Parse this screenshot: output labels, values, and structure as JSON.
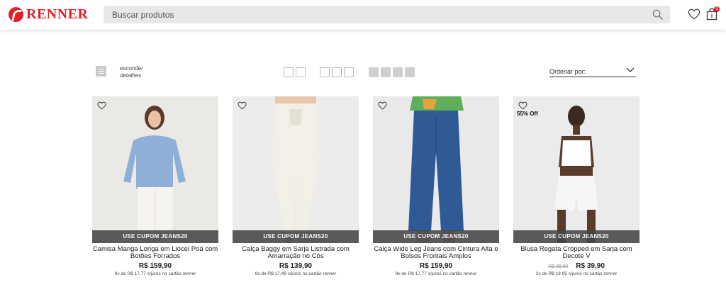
{
  "brand": {
    "name": "RENNER",
    "accent": "#e21f26"
  },
  "search": {
    "placeholder": "Buscar produtos"
  },
  "header": {
    "wishlist_icon": "heart-icon",
    "bag_icon": "shopping-bag-icon",
    "bag_count": "0"
  },
  "toolbar": {
    "details_label_line1": "esconder",
    "details_label_line2": "detalhes",
    "grid_options": [
      "2 columns",
      "3 columns",
      "4 columns"
    ],
    "active_grid": "4 columns",
    "sort_label": "Ordenar por:"
  },
  "products": [
    {
      "name": "Camisa Manga Longa em Liocel Poá com Botões Forrados",
      "coupon": "USE CUPOM JEANS20",
      "price": "R$ 159,90",
      "old_price": "",
      "discount": "",
      "installments": "9x de R$ 17,77 s/juros no cartão renner",
      "photo_bg": "#ebe9e6"
    },
    {
      "name": "Calça Baggy em Sarja Listrada com Amarração no Cós",
      "coupon": "USE CUPOM JEANS20",
      "price": "R$ 139,90",
      "old_price": "",
      "discount": "",
      "installments": "8x de R$ 17,49 s/juros no cartão renner",
      "photo_bg": "#ececea"
    },
    {
      "name": "Calça Wide Leg Jeans com Cintura Alta e Bolsos Frontais Amplos",
      "coupon": "USE CUPOM JEANS20",
      "price": "R$ 159,90",
      "old_price": "",
      "discount": "",
      "installments": "9x de R$ 17,77 s/juros no cartão renner",
      "photo_bg": "#e9e9e9"
    },
    {
      "name": "Blusa Regata Cropped em Sarja com Decote V",
      "coupon": "USE CUPOM JEANS20",
      "price": "R$ 39,90",
      "old_price": "R$ 89,90",
      "discount": "55% Off",
      "installments": "2x de R$ 19,95 s/juros no cartão renner",
      "photo_bg": "#ebebeb"
    }
  ]
}
